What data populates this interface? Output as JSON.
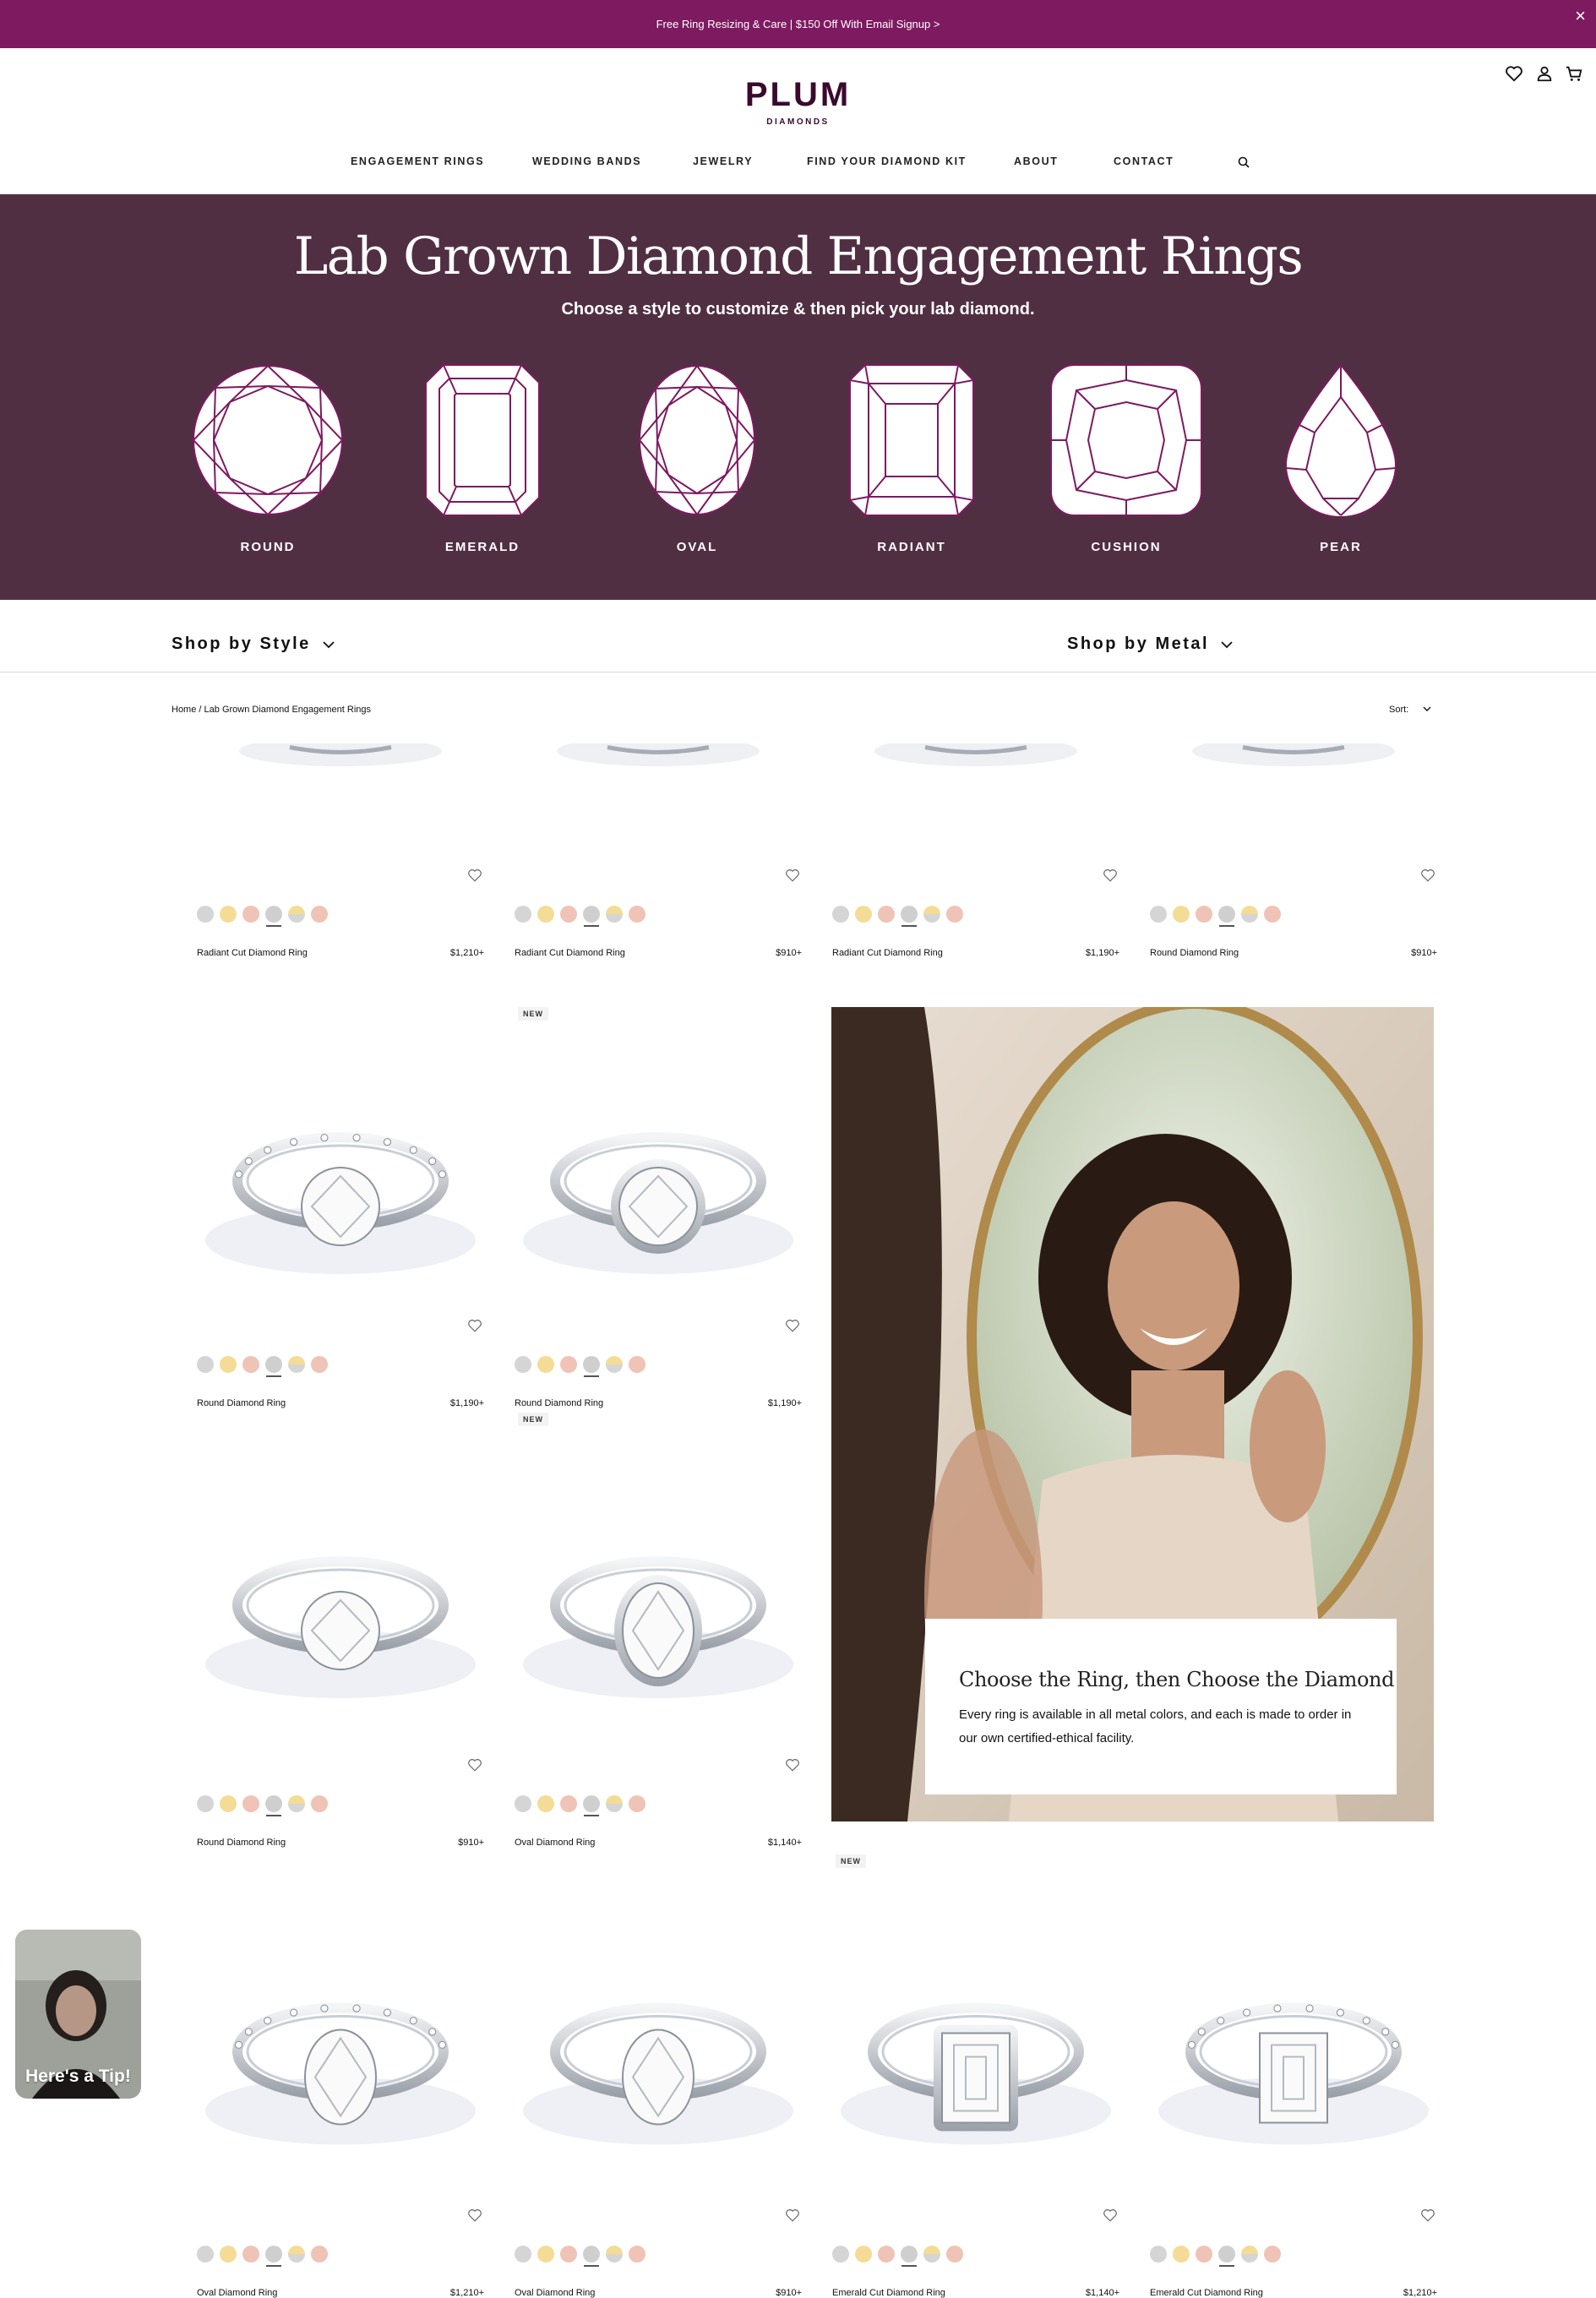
{
  "announcement": {
    "text": "Free Ring Resizing & Care | $150 Off With Email Signup >",
    "close": "×"
  },
  "logo": {
    "word": "PLUM",
    "sub": "DIAMONDS"
  },
  "nav": [
    "ENGAGEMENT RINGS",
    "WEDDING BANDS",
    "JEWELRY",
    "FIND YOUR DIAMOND KIT",
    "ABOUT",
    "CONTACT"
  ],
  "hero": {
    "title": "Lab Grown Diamond Engagement Rings",
    "subtitle": "Choose a style to customize & then pick your lab diamond.",
    "shapes": [
      "ROUND",
      "EMERALD",
      "OVAL",
      "RADIANT",
      "CUSHION",
      "PEAR"
    ]
  },
  "filters": {
    "style": "Shop by Style",
    "metal": "Shop by Metal"
  },
  "breadcrumb": {
    "home": "Home",
    "separator": "/",
    "current": "Lab Grown Diamond Engagement Rings"
  },
  "sort": {
    "label": "Sort:"
  },
  "swatch_colors": [
    "#d5d5d5",
    "#f4dc96",
    "#efc3b5",
    "#cfcfcf",
    "half-yellow-white",
    "#efc3b5"
  ],
  "products": [
    {
      "name": "Radiant Cut Diamond Ring",
      "price": "$1,210+",
      "badge": "",
      "shape": "radiant-top"
    },
    {
      "name": "Radiant Cut Diamond Ring",
      "price": "$910+",
      "badge": "",
      "shape": "radiant-top"
    },
    {
      "name": "Radiant Cut Diamond Ring",
      "price": "$1,190+",
      "badge": "",
      "shape": "radiant-top"
    },
    {
      "name": "Round Diamond Ring",
      "price": "$910+",
      "badge": "",
      "shape": "round-top"
    },
    {
      "name": "Round Diamond Ring",
      "price": "$1,190+",
      "badge": "",
      "shape": "round-pave"
    },
    {
      "name": "Round Diamond Ring",
      "price": "$1,190+",
      "badge": "NEW",
      "shape": "round-bezel"
    },
    {
      "name": "Round Diamond Ring",
      "price": "$910+",
      "badge": "",
      "shape": "round-solitaire"
    },
    {
      "name": "Oval Diamond Ring",
      "price": "$1,140+",
      "badge": "NEW",
      "shape": "oval-bezel"
    },
    {
      "name": "Oval Diamond Ring",
      "price": "$1,210+",
      "badge": "",
      "shape": "oval-pave"
    },
    {
      "name": "Oval Diamond Ring",
      "price": "$910+",
      "badge": "",
      "shape": "oval-solitaire"
    },
    {
      "name": "Emerald Cut Diamond Ring",
      "price": "$1,140+",
      "badge": "NEW",
      "shape": "emerald-bezel"
    },
    {
      "name": "Emerald Cut Diamond Ring",
      "price": "$1,210+",
      "badge": "",
      "shape": "emerald-pave"
    }
  ],
  "promo": {
    "title": "Choose the Ring, then Choose the Diamond",
    "text": "Every ring is available in all metal colors, and each is made to order in our own certified-ethical facility."
  },
  "tip_widget": {
    "label": "Here's a Tip!"
  },
  "colors": {
    "announcement_bg": "#7d1a60",
    "hero_bg": "#512f43",
    "logo": "#3a0a2e"
  }
}
